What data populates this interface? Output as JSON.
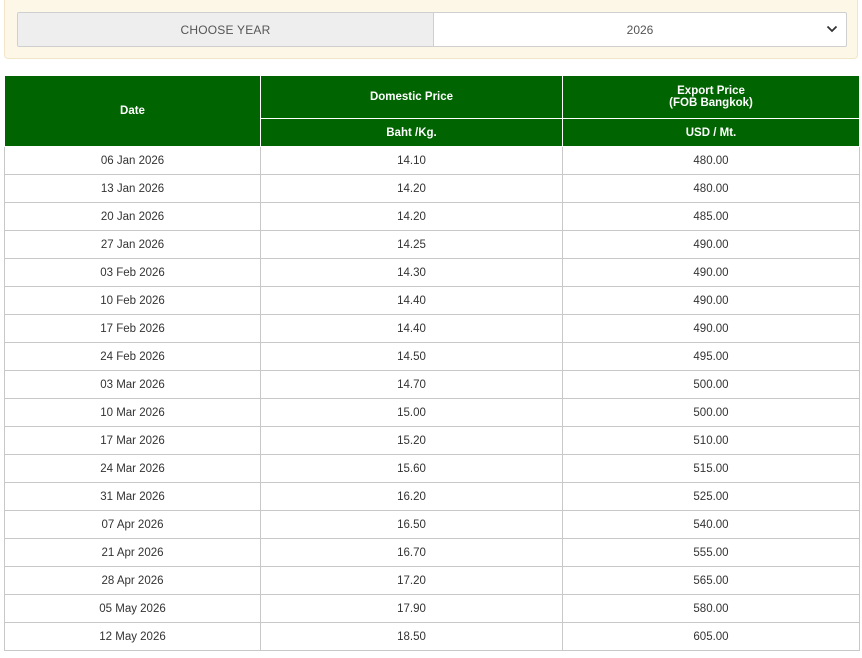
{
  "filter": {
    "label": "CHOOSE YEAR",
    "selected_year": "2026"
  },
  "table": {
    "headers": {
      "date": "Date",
      "domestic": "Domestic Price",
      "export_line1": "Export Price",
      "export_line2": "(FOB Bangkok)",
      "domestic_unit": "Baht /Kg.",
      "export_unit": "USD / Mt."
    },
    "rows": [
      {
        "date": "06 Jan 2026",
        "domestic": "14.10",
        "export": "480.00"
      },
      {
        "date": "13 Jan 2026",
        "domestic": "14.20",
        "export": "480.00"
      },
      {
        "date": "20 Jan 2026",
        "domestic": "14.20",
        "export": "485.00"
      },
      {
        "date": "27 Jan 2026",
        "domestic": "14.25",
        "export": "490.00"
      },
      {
        "date": "03 Feb 2026",
        "domestic": "14.30",
        "export": "490.00"
      },
      {
        "date": "10 Feb 2026",
        "domestic": "14.40",
        "export": "490.00"
      },
      {
        "date": "17 Feb 2026",
        "domestic": "14.40",
        "export": "490.00"
      },
      {
        "date": "24 Feb 2026",
        "domestic": "14.50",
        "export": "495.00"
      },
      {
        "date": "03 Mar 2026",
        "domestic": "14.70",
        "export": "500.00"
      },
      {
        "date": "10 Mar 2026",
        "domestic": "15.00",
        "export": "500.00"
      },
      {
        "date": "17 Mar 2026",
        "domestic": "15.20",
        "export": "510.00"
      },
      {
        "date": "24 Mar 2026",
        "domestic": "15.60",
        "export": "515.00"
      },
      {
        "date": "31 Mar 2026",
        "domestic": "16.20",
        "export": "525.00"
      },
      {
        "date": "07 Apr 2026",
        "domestic": "16.50",
        "export": "540.00"
      },
      {
        "date": "21 Apr 2026",
        "domestic": "16.70",
        "export": "555.00"
      },
      {
        "date": "28 Apr 2026",
        "domestic": "17.20",
        "export": "565.00"
      },
      {
        "date": "05 May 2026",
        "domestic": "17.90",
        "export": "580.00"
      },
      {
        "date": "12 May 2026",
        "domestic": "18.50",
        "export": "605.00"
      }
    ]
  },
  "colors": {
    "header_green": "#006400",
    "filter_bg": "#fdf7e7"
  }
}
